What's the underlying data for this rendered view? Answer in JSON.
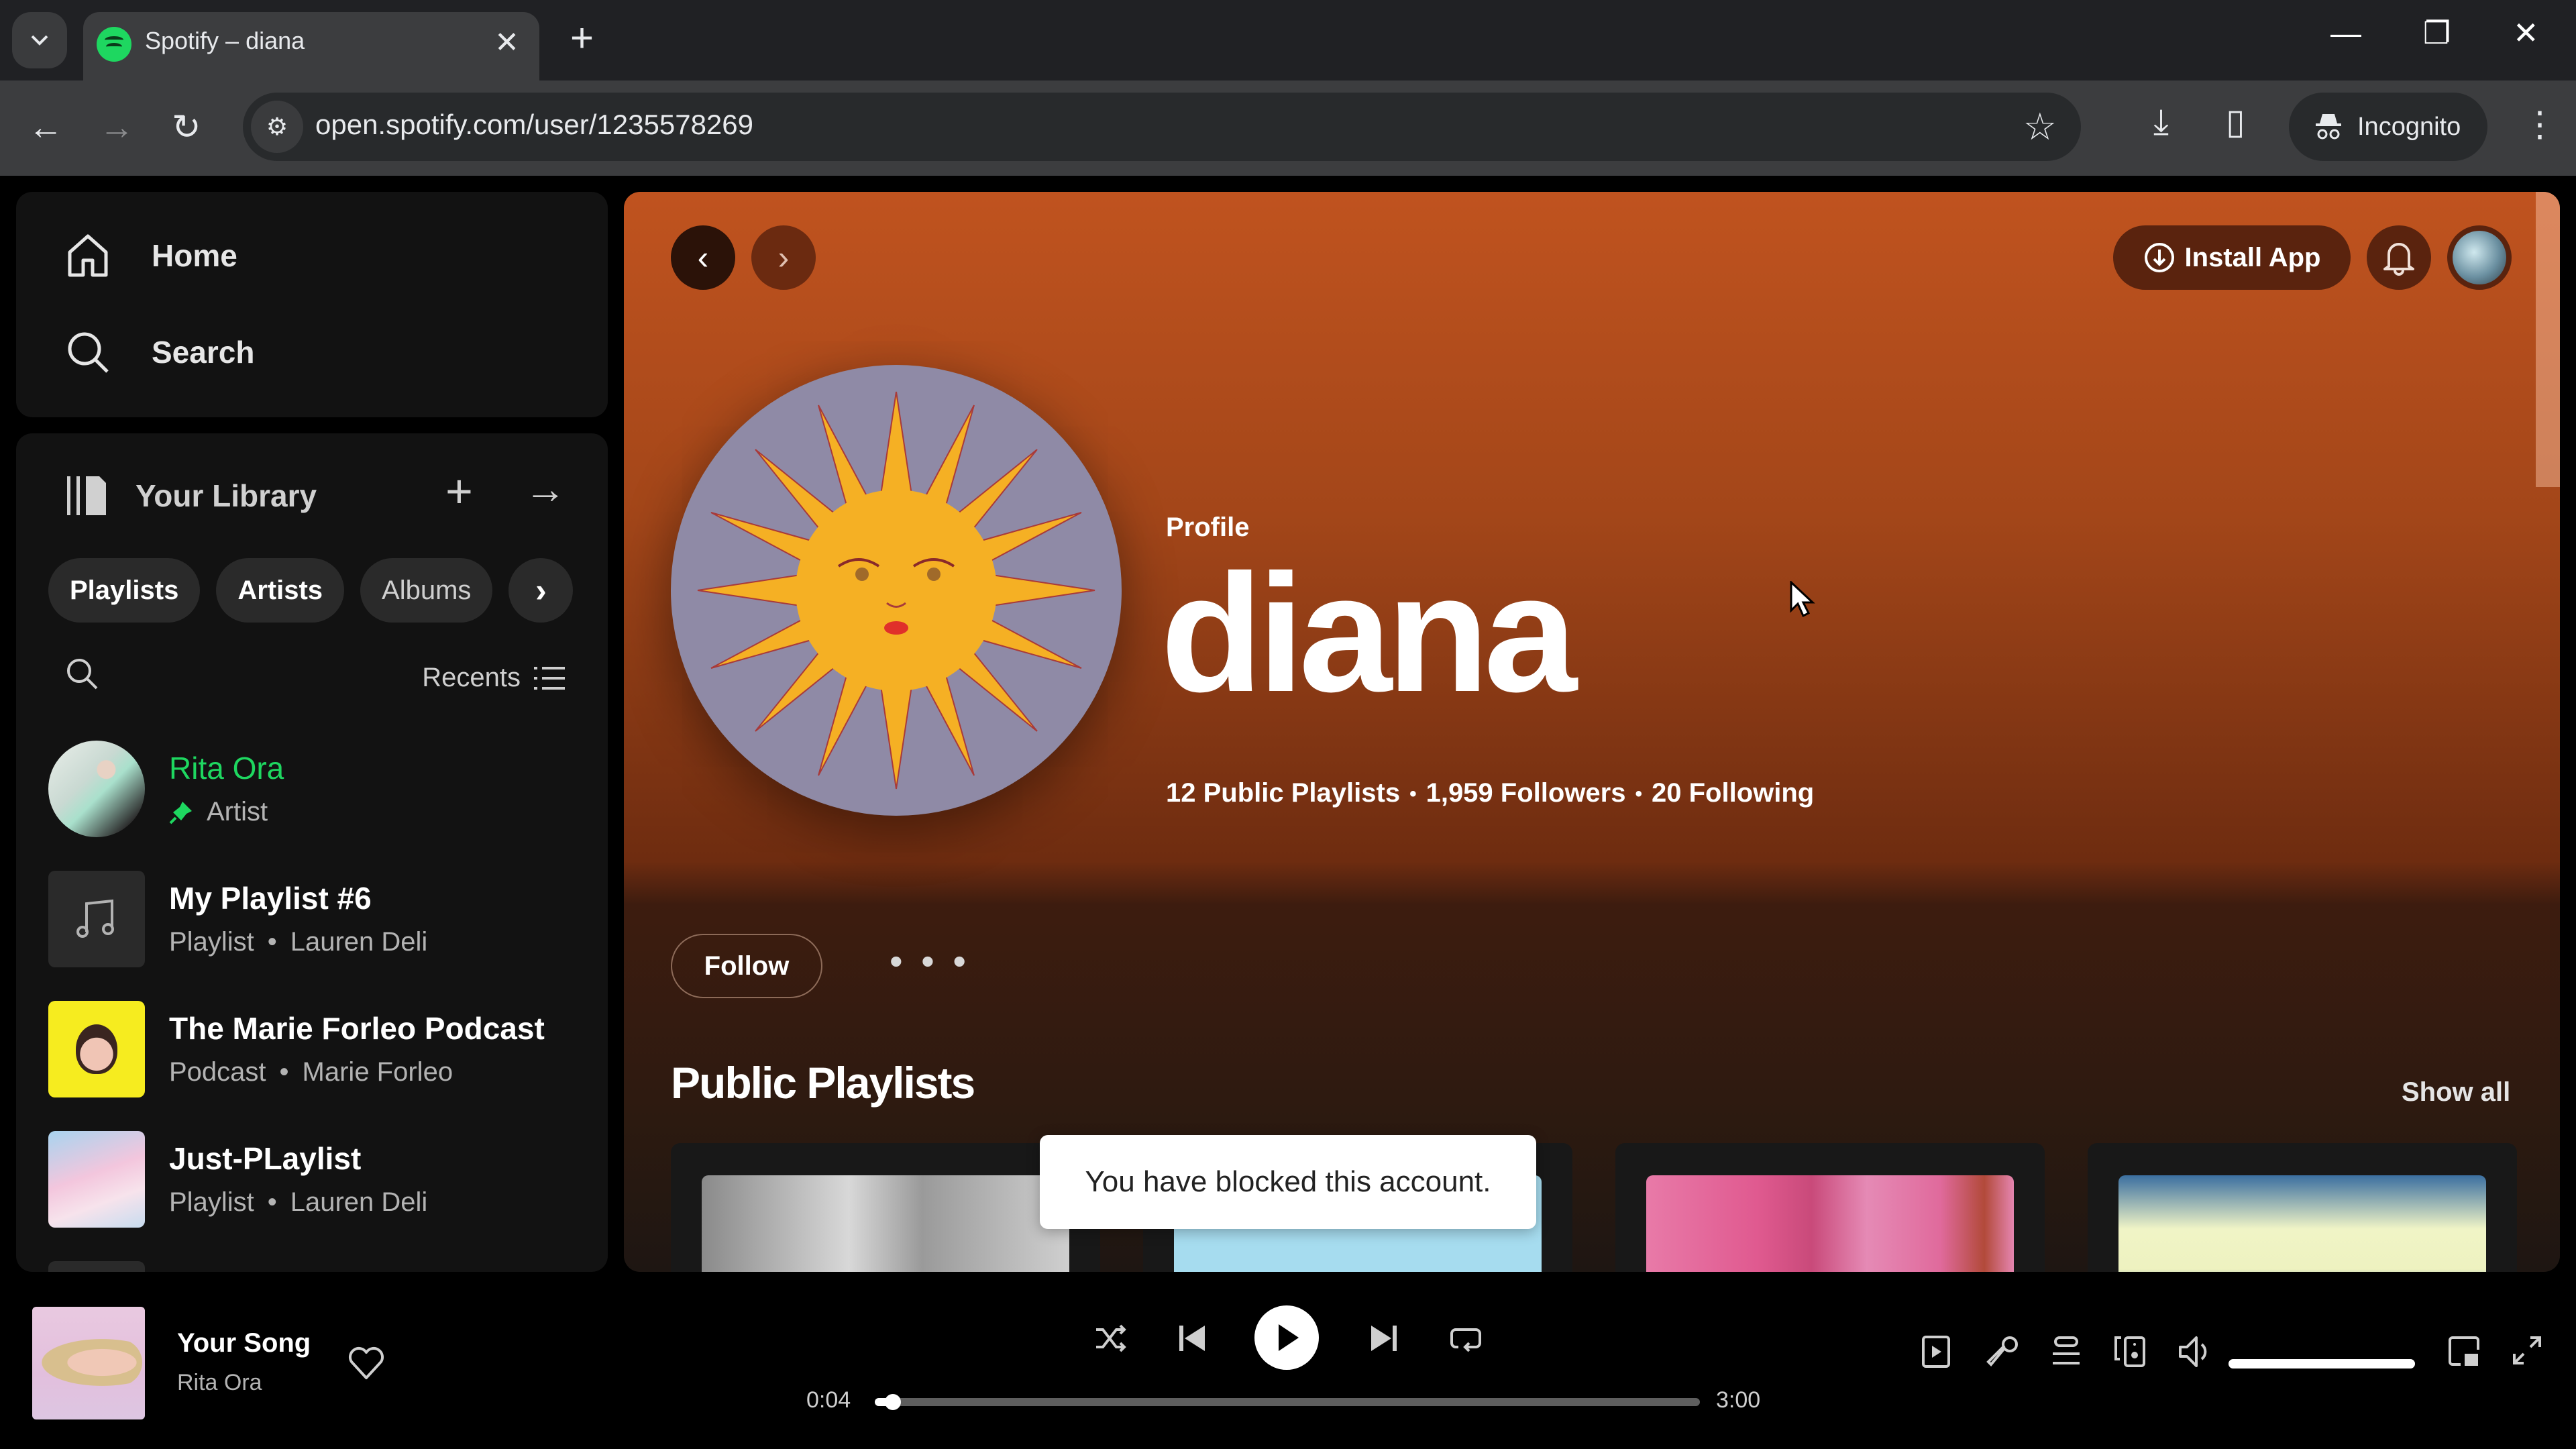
{
  "browser": {
    "tab_title": "Spotify – diana",
    "url": "open.spotify.com/user/1235578269",
    "incognito_label": "Incognito"
  },
  "sidebar": {
    "nav": [
      {
        "label": "Home",
        "icon": "home-icon"
      },
      {
        "label": "Search",
        "icon": "search-icon"
      }
    ],
    "library": {
      "title": "Your Library",
      "filters": [
        "Playlists",
        "Artists",
        "Albums"
      ],
      "sort_label": "Recents",
      "items": [
        {
          "title": "Rita Ora",
          "type": "Artist",
          "owner": "",
          "pinned": true,
          "active": true
        },
        {
          "title": "My Playlist #6",
          "type": "Playlist",
          "owner": "Lauren Deli",
          "pinned": false
        },
        {
          "title": "The Marie Forleo Podcast",
          "type": "Podcast",
          "owner": "Marie Forleo",
          "pinned": false
        },
        {
          "title": "Just-PLaylist",
          "type": "Playlist",
          "owner": "Lauren Deli",
          "pinned": false
        }
      ],
      "separator": "•"
    }
  },
  "main": {
    "install_label": "Install App",
    "profile": {
      "label": "Profile",
      "name": "diana",
      "stats": [
        "12 Public Playlists",
        "1,959 Followers",
        "20 Following"
      ]
    },
    "follow_label": "Follow",
    "more_label": "• • •",
    "section_title": "Public Playlists",
    "show_all_label": "Show all",
    "toast": "You have blocked this account.",
    "header_color": "#c0531f"
  },
  "player": {
    "track_title": "Your Song",
    "track_artist": "Rita Ora",
    "elapsed": "0:04",
    "duration": "3:00",
    "progress_fraction": 0.022,
    "volume_fraction": 1.0
  },
  "colors": {
    "spotify_green": "#1ed760",
    "panel_bg": "#121212"
  }
}
